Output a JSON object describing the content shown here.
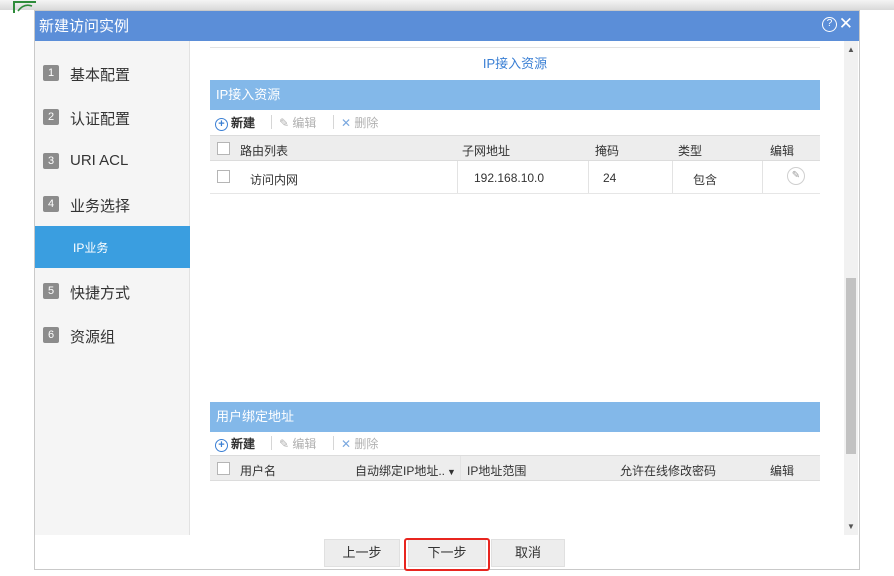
{
  "window": {
    "title": "新建访问实例",
    "help_icon": "help-circle-icon",
    "close_icon": "close-icon"
  },
  "sidebar": {
    "steps": [
      {
        "num": "1",
        "label": "基本配置"
      },
      {
        "num": "2",
        "label": "认证配置"
      },
      {
        "num": "3",
        "label": "URI ACL"
      },
      {
        "num": "4",
        "label": "业务选择"
      },
      {
        "num": "5",
        "label": "快捷方式"
      },
      {
        "num": "6",
        "label": "资源组"
      }
    ],
    "active_sub": {
      "label": "IP业务"
    }
  },
  "content": {
    "title": "IP接入资源",
    "ip_section": {
      "header": "IP接入资源",
      "toolbar": {
        "new": "新建",
        "edit": "编辑",
        "delete": "删除"
      },
      "columns": [
        "路由列表",
        "子网地址",
        "掩码",
        "类型",
        "编辑"
      ],
      "rows": [
        {
          "route": "访问内网",
          "subnet": "192.168.10.0",
          "mask": "24",
          "type": "包含"
        }
      ]
    },
    "user_section": {
      "header": "用户绑定地址",
      "toolbar": {
        "new": "新建",
        "edit": "编辑",
        "delete": "删除"
      },
      "columns": [
        "用户名",
        "自动绑定IP地址..",
        "IP地址范围",
        "允许在线修改密码",
        "编辑"
      ]
    }
  },
  "footer": {
    "prev": "上一步",
    "next": "下一步",
    "cancel": "取消"
  },
  "colors": {
    "titlebar": "#5b8ed8",
    "section_header": "#83b8e9",
    "active_step": "#3a9ee0",
    "highlight": "#e8251f"
  }
}
